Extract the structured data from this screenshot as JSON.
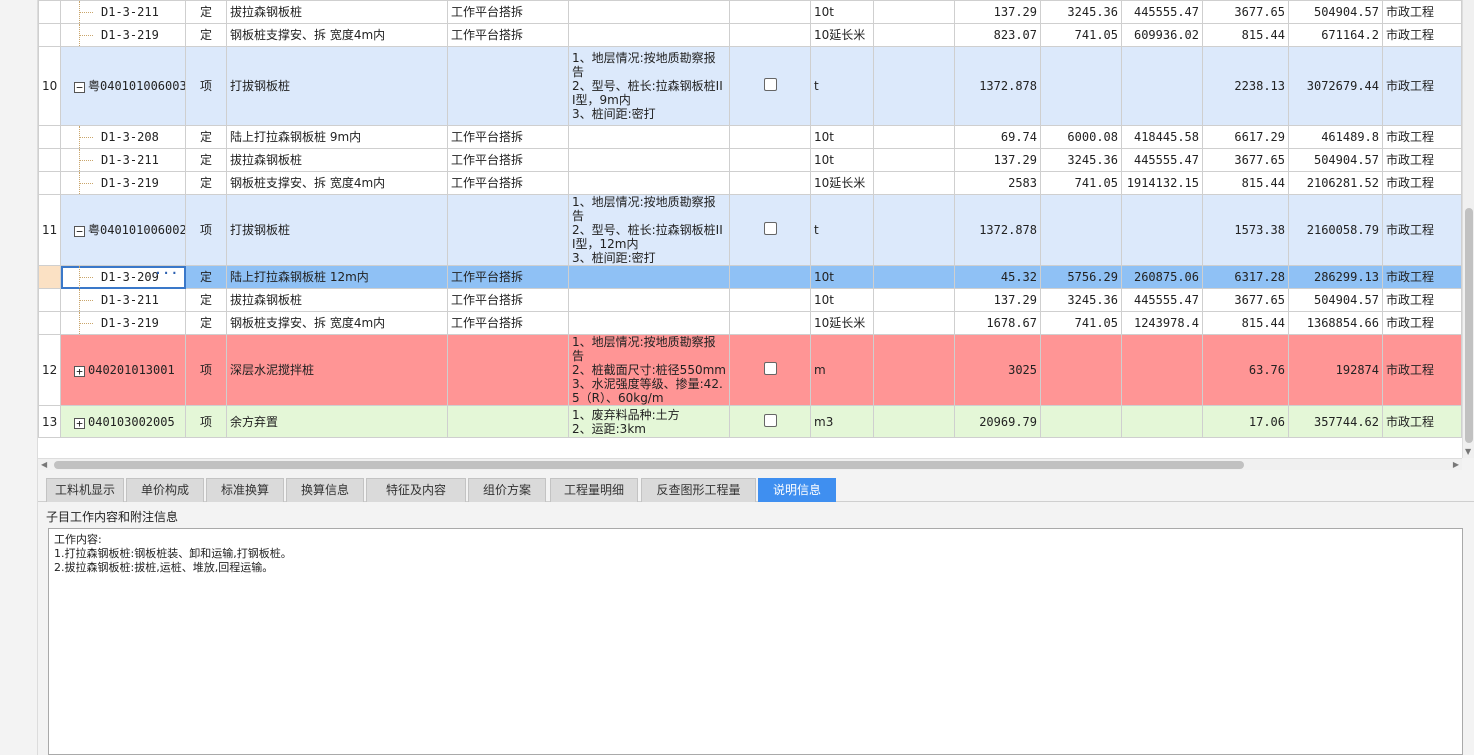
{
  "grid": {
    "rows": [
      {
        "idx": "",
        "code": "D1-3-211",
        "type": "定",
        "name": "拔拉森钢板桩",
        "work": "工作平台搭拆",
        "feature": "",
        "unit": "10t",
        "qty": "137.29",
        "price": "3245.36",
        "total": "445555.47",
        "c1": "3677.65",
        "c2": "504904.57",
        "cat": "市政工程"
      },
      {
        "idx": "",
        "code": "D1-3-219",
        "type": "定",
        "name": "钢板桩支撑安、拆 宽度4m内",
        "work": "工作平台搭拆",
        "feature": "",
        "unit": "10延长米",
        "qty": "823.07",
        "price": "741.05",
        "total": "609936.02",
        "c1": "815.44",
        "c2": "671164.2",
        "cat": "市政工程"
      },
      {
        "idx": "10",
        "code": "粤040101006003",
        "type": "项",
        "name": "打拔钢板桩",
        "work": "",
        "feature": "1、地层情况:按地质勘察报告\n2、型号、桩长:拉森钢板桩III型，9m内\n3、桩间距:密打",
        "unit": "t",
        "qty": "1372.878",
        "price": "",
        "total": "",
        "c1": "2238.13",
        "c2": "3072679.44",
        "cat": "市政工程"
      },
      {
        "idx": "",
        "code": "D1-3-208",
        "type": "定",
        "name": "陆上打拉森钢板桩 9m内",
        "work": "工作平台搭拆",
        "feature": "",
        "unit": "10t",
        "qty": "69.74",
        "price": "6000.08",
        "total": "418445.58",
        "c1": "6617.29",
        "c2": "461489.8",
        "cat": "市政工程"
      },
      {
        "idx": "",
        "code": "D1-3-211",
        "type": "定",
        "name": "拔拉森钢板桩",
        "work": "工作平台搭拆",
        "feature": "",
        "unit": "10t",
        "qty": "137.29",
        "price": "3245.36",
        "total": "445555.47",
        "c1": "3677.65",
        "c2": "504904.57",
        "cat": "市政工程"
      },
      {
        "idx": "",
        "code": "D1-3-219",
        "type": "定",
        "name": "钢板桩支撑安、拆 宽度4m内",
        "work": "工作平台搭拆",
        "feature": "",
        "unit": "10延长米",
        "qty": "2583",
        "price": "741.05",
        "total": "1914132.15",
        "c1": "815.44",
        "c2": "2106281.52",
        "cat": "市政工程"
      },
      {
        "idx": "11",
        "code": "粤040101006002",
        "type": "项",
        "name": "打拔钢板桩",
        "work": "",
        "feature": "1、地层情况:按地质勘察报告\n2、型号、桩长:拉森钢板桩III型，12m内\n3、桩间距:密打",
        "unit": "t",
        "qty": "1372.878",
        "price": "",
        "total": "",
        "c1": "1573.38",
        "c2": "2160058.79",
        "cat": "市政工程"
      },
      {
        "idx": "",
        "code": "D1-3-209",
        "type": "定",
        "name": "陆上打拉森钢板桩 12m内",
        "work": "工作平台搭拆",
        "feature": "",
        "unit": "10t",
        "qty": "45.32",
        "price": "5756.29",
        "total": "260875.06",
        "c1": "6317.28",
        "c2": "286299.13",
        "cat": "市政工程"
      },
      {
        "idx": "",
        "code": "D1-3-211",
        "type": "定",
        "name": "拔拉森钢板桩",
        "work": "工作平台搭拆",
        "feature": "",
        "unit": "10t",
        "qty": "137.29",
        "price": "3245.36",
        "total": "445555.47",
        "c1": "3677.65",
        "c2": "504904.57",
        "cat": "市政工程"
      },
      {
        "idx": "",
        "code": "D1-3-219",
        "type": "定",
        "name": "钢板桩支撑安、拆 宽度4m内",
        "work": "工作平台搭拆",
        "feature": "",
        "unit": "10延长米",
        "qty": "1678.67",
        "price": "741.05",
        "total": "1243978.4",
        "c1": "815.44",
        "c2": "1368854.66",
        "cat": "市政工程"
      },
      {
        "idx": "12",
        "code": "040201013001",
        "type": "项",
        "name": "深层水泥搅拌桩",
        "work": "",
        "feature": "1、地层情况:按地质勘察报告\n2、桩截面尺寸:桩径550mm\n3、水泥强度等级、掺量:42.5（R）、60kg/m",
        "unit": "m",
        "qty": "3025",
        "price": "",
        "total": "",
        "c1": "63.76",
        "c2": "192874",
        "cat": "市政工程"
      },
      {
        "idx": "13",
        "code": "040103002005",
        "type": "项",
        "name": "余方弃置",
        "work": "",
        "feature": "1、废弃料品种:土方\n2、运距:3km",
        "unit": "m3",
        "qty": "20969.79",
        "price": "",
        "total": "",
        "c1": "17.06",
        "c2": "357744.62",
        "cat": "市政工程"
      }
    ],
    "toggle_minus": "−",
    "toggle_plus": "+",
    "ellipsis": "···"
  },
  "tabs": [
    {
      "label": "工料机显示"
    },
    {
      "label": "单价构成"
    },
    {
      "label": "标准换算"
    },
    {
      "label": "换算信息"
    },
    {
      "label": "特征及内容"
    },
    {
      "label": "组价方案"
    },
    {
      "label": "工程量明细"
    },
    {
      "label": "反查图形工程量"
    },
    {
      "label": "说明信息"
    }
  ],
  "active_tab": "说明信息",
  "panel": {
    "title": "子目工作内容和附注信息",
    "content": "工作内容:\n1.打拉森钢板桩:钢板桩装、卸和运输,打钢板桩。\n2.拔拉森钢板桩:拔桩,运桩、堆放,回程运输。"
  },
  "colors": {
    "main_row": "#dce9fb",
    "selected_row": "#8fc1f5",
    "red_row": "#ff9595",
    "green_row": "#e4f7d7",
    "active_tab": "#3f8ff0"
  }
}
